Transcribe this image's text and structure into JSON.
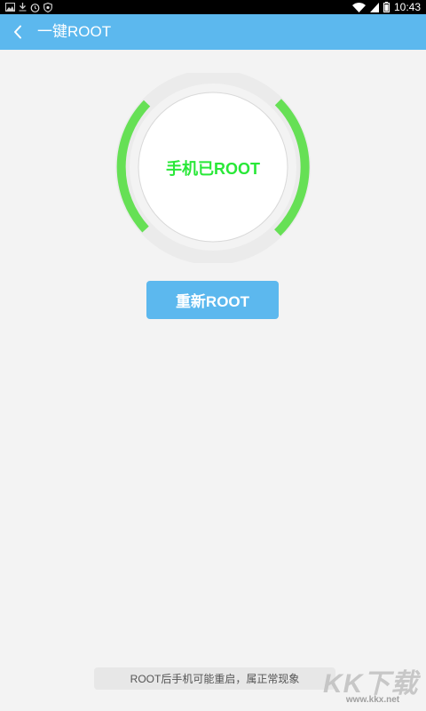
{
  "status_bar": {
    "time": "10:43",
    "left_icons": [
      "gallery-icon",
      "download-icon",
      "alarm-icon",
      "shield-icon"
    ],
    "right_icons": [
      "wifi-icon",
      "signal-icon",
      "battery-icon"
    ]
  },
  "header": {
    "title": "一键ROOT",
    "back_icon": "chevron-left-icon"
  },
  "root_status": {
    "text": "手机已ROOT",
    "ring_color": "#66e055",
    "text_color": "#29e838"
  },
  "actions": {
    "reroot_label": "重新ROOT"
  },
  "footer": {
    "notice": "ROOT后手机可能重启，属正常现象"
  },
  "watermark": {
    "logo_text": "KK下载",
    "url": "www.kkx.net"
  },
  "colors": {
    "accent": "#5cb8ee",
    "background": "#f3f3f3"
  }
}
